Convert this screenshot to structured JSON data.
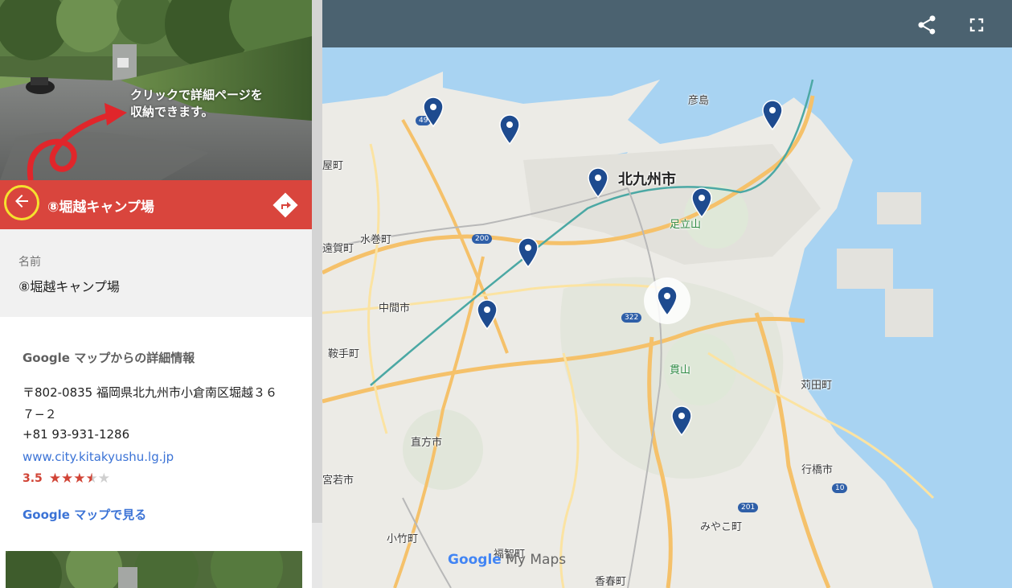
{
  "callout": {
    "text": "クリックで詳細ページを\n収納できます。"
  },
  "panel": {
    "title": "⑧堀越キャンプ場",
    "name_label": "名前",
    "name_value": "⑧堀越キャンプ場",
    "details_heading": "Google マップからの詳細情報",
    "address": "〒802-0835 福岡県北九州市小倉南区堀越３６７−２",
    "phone": "+81 93-931-1286",
    "website": "www.city.kitakyushu.lg.jp",
    "rating": "3.5",
    "rating_stars": 3.5,
    "stars_full": "★★★",
    "stars_half": "★",
    "stars_empty": "★",
    "gmaps_link": "Google マップで見る"
  },
  "icons": {
    "back": "arrow-left-icon",
    "directions": "directions-icon",
    "share": "share-icon",
    "fullscreen": "fullscreen-icon",
    "marker": "map-pin-icon"
  },
  "colors": {
    "title_bar": "#d9453d",
    "map_header": "#4b6270",
    "marker": "#1e4b8f",
    "link": "#3b73d6",
    "highlight_ring": "#f5e12e"
  },
  "map": {
    "labels": [
      {
        "text": "北九州市",
        "kind": "big"
      },
      {
        "text": "彦島",
        "kind": "place"
      },
      {
        "text": "足立山",
        "kind": "park"
      },
      {
        "text": "水巻町",
        "kind": "place"
      },
      {
        "text": "遠賀町",
        "kind": "place"
      },
      {
        "text": "屋町",
        "kind": "place"
      },
      {
        "text": "中間市",
        "kind": "place"
      },
      {
        "text": "鞍手町",
        "kind": "place"
      },
      {
        "text": "貫山",
        "kind": "park"
      },
      {
        "text": "苅田町",
        "kind": "place"
      },
      {
        "text": "直方市",
        "kind": "place"
      },
      {
        "text": "宮若市",
        "kind": "place"
      },
      {
        "text": "行橋市",
        "kind": "place"
      },
      {
        "text": "みやこ町",
        "kind": "place"
      },
      {
        "text": "小竹町",
        "kind": "place"
      },
      {
        "text": "福智町",
        "kind": "place"
      },
      {
        "text": "香春町",
        "kind": "place"
      }
    ],
    "route_shields": [
      "49",
      "200",
      "322",
      "201",
      "10"
    ],
    "watermark_google": "Google",
    "watermark_mymaps": " My Maps",
    "markers_count": 9
  }
}
